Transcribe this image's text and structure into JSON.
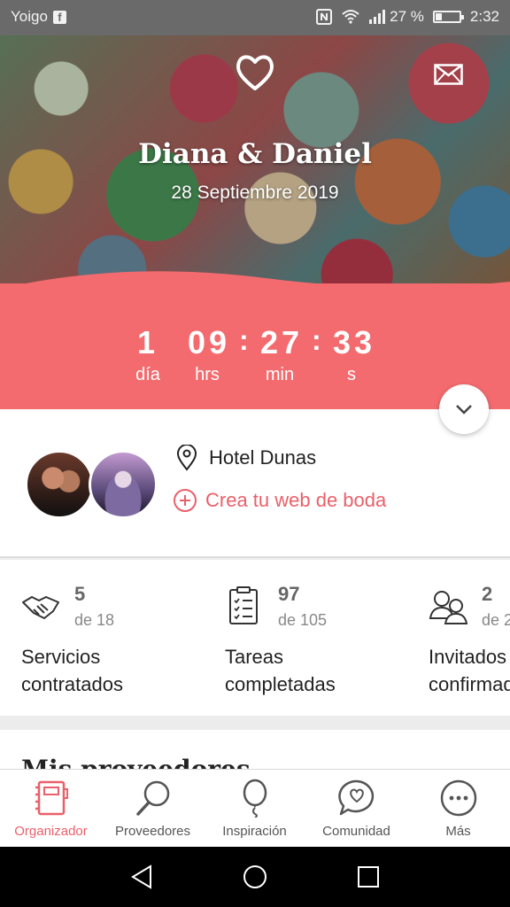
{
  "status_bar": {
    "carrier": "Yoigo",
    "battery_text": "27 %",
    "battery_level": 0.27,
    "time": "2:32",
    "icons": [
      "facebook-icon",
      "nfc-icon",
      "wifi-icon",
      "signal-icon",
      "battery-icon"
    ]
  },
  "hero": {
    "couple": "Diana & Daniel",
    "date": "28 Septiembre 2019",
    "icons": [
      "heart-icon",
      "mail-icon"
    ]
  },
  "countdown": {
    "days": "1",
    "days_label": "día",
    "hours": "09",
    "hours_label": "hrs",
    "minutes": "27",
    "minutes_label": "min",
    "seconds": "33",
    "seconds_label": "s",
    "separator": ":"
  },
  "venue": {
    "name": "Hotel Dunas",
    "web_link": "Crea tu web de boda"
  },
  "stats": [
    {
      "number": "5",
      "of": "de 18",
      "label_line1": "Servicios",
      "label_line2": "contratados",
      "icon": "handshake-icon"
    },
    {
      "number": "97",
      "of": "de 105",
      "label_line1": "Tareas",
      "label_line2": "completadas",
      "icon": "checklist-icon"
    },
    {
      "number": "2",
      "of": "de 2",
      "label_line1": "Invitados",
      "label_line2": "confirmados",
      "icon": "guests-icon"
    }
  ],
  "providers": {
    "title": "Mis proveedores"
  },
  "bottom_nav": [
    {
      "label": "Organizador",
      "icon": "notebook-icon",
      "active": true
    },
    {
      "label": "Proveedores",
      "icon": "search-icon",
      "active": false
    },
    {
      "label": "Inspiración",
      "icon": "balloon-icon",
      "active": false
    },
    {
      "label": "Comunidad",
      "icon": "chat-heart-icon",
      "active": false
    },
    {
      "label": "Más",
      "icon": "more-icon",
      "active": false
    }
  ],
  "colors": {
    "accent": "#f36b6e",
    "link": "#e9606a"
  }
}
